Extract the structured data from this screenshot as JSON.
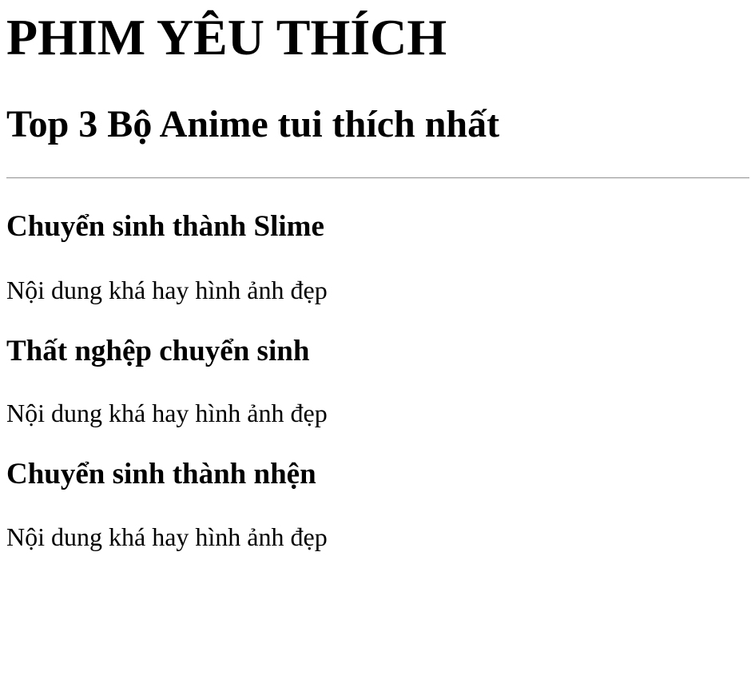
{
  "page": {
    "title": "PHIM YÊU THÍCH",
    "subtitle": "Top 3 Bộ Anime tui thích nhất"
  },
  "items": [
    {
      "title": "Chuyển sinh thành Slime",
      "description": "Nội dung khá hay hình ảnh đẹp"
    },
    {
      "title": "Thất nghệp chuyển sinh",
      "description": "Nội dung khá hay hình ảnh đẹp"
    },
    {
      "title": "Chuyển sinh thành nhện",
      "description": "Nội dung khá hay hình ảnh đẹp"
    }
  ]
}
